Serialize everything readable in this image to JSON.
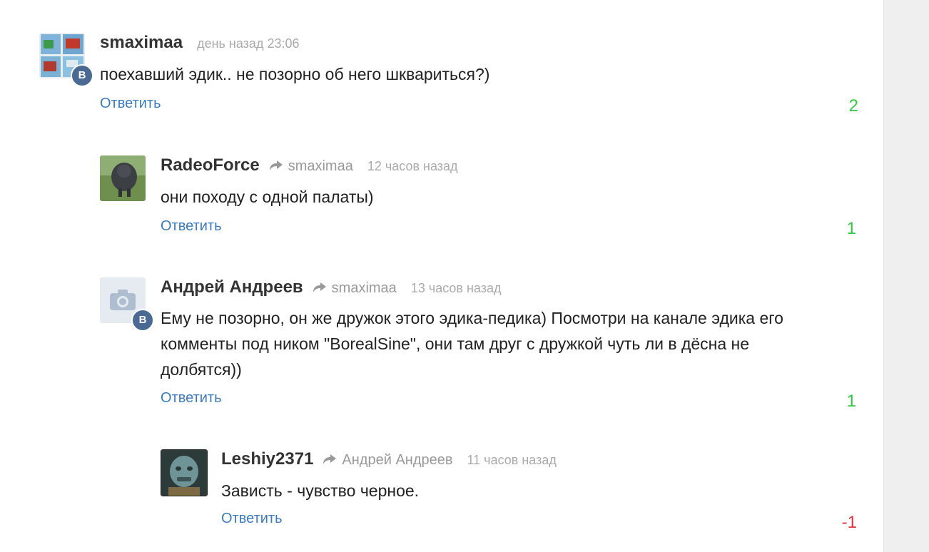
{
  "comments": [
    {
      "author": "smaximaa",
      "reply_to": "",
      "time": "день назад 23:06",
      "text": "поехавший эдик.. не позорно об него шквариться?)",
      "reply_label": "Ответить",
      "score": "2",
      "badge": "В"
    },
    {
      "author": "RadeoForce",
      "reply_to": "smaximaa",
      "time": "12 часов назад",
      "text": "они походу с одной палаты)",
      "reply_label": "Ответить",
      "score": "1"
    },
    {
      "author": "Андрей Андреев",
      "reply_to": "smaximaa",
      "time": "13 часов назад",
      "text_lines": [
        "Ему не позорно, он же дружок этого эдика-педика) Посмотри на канале эдика его",
        "комменты под ником \"BorealSine\", они там друг с дружкой чуть ли в дёсна не",
        "долбятся))"
      ],
      "reply_label": "Ответить",
      "score": "1",
      "badge": "В"
    },
    {
      "author": "Leshiy2371",
      "reply_to": "Андрей Андреев",
      "time": "11 часов назад",
      "text": "Зависть - чувство черное.",
      "reply_label": "Ответить",
      "score": "-1"
    }
  ],
  "colors": {
    "link": "#3b7bbf",
    "positive": "#2ecc40",
    "negative": "#e0363f",
    "vk_badge": "#4a6a94"
  },
  "icons": [
    "reply-arrow-icon",
    "camera-icon",
    "vk-icon"
  ]
}
